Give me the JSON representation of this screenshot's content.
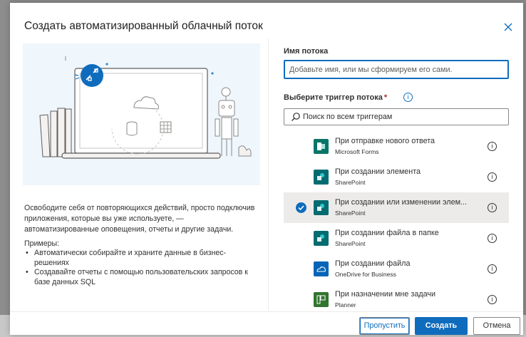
{
  "dialog": {
    "title": "Создать автоматизированный облачный поток",
    "close_label": "×"
  },
  "left": {
    "description": "Освободите себя от повторяющихся действий, просто подключив приложения, которые вы уже используете, — автоматизированные оповещения, отчеты и другие задачи.",
    "examples_title": "Примеры:",
    "examples": [
      "Автоматически собирайте и храните данные в бизнес-решениях",
      "Создавайте отчеты с помощью пользовательских запросов к базе данных SQL"
    ]
  },
  "flow_name": {
    "label": "Имя потока",
    "placeholder": "Добавьте имя, или мы сформируем его сами.",
    "value": ""
  },
  "trigger": {
    "label": "Выберите триггер потока",
    "required_mark": "*",
    "info_icon": "info-icon",
    "search_placeholder": "Поиск по всем триггерам",
    "items": [
      {
        "title": "При отправке нового ответа",
        "subtitle": "Microsoft Forms",
        "icon": "forms-icon",
        "color": "#077568",
        "selected": false
      },
      {
        "title": "При создании элемента",
        "subtitle": "SharePoint",
        "icon": "sharepoint-icon",
        "color": "#036c70",
        "selected": false
      },
      {
        "title": "При создании или изменении элем...",
        "subtitle": "SharePoint",
        "icon": "sharepoint-icon",
        "color": "#036c70",
        "selected": true
      },
      {
        "title": "При создании файла в папке",
        "subtitle": "SharePoint",
        "icon": "sharepoint-icon",
        "color": "#036c70",
        "selected": false
      },
      {
        "title": "При создании файла",
        "subtitle": "OneDrive for Business",
        "icon": "onedrive-icon",
        "color": "#0364b8",
        "selected": false
      },
      {
        "title": "При назначении мне задачи",
        "subtitle": "Planner",
        "icon": "planner-icon",
        "color": "#31752f",
        "selected": false
      }
    ]
  },
  "footer": {
    "skip_label": "Пропустить",
    "create_label": "Создать",
    "cancel_label": "Отмена"
  },
  "colors": {
    "accent": "#0f6cbd",
    "selected_row": "#edebe9"
  }
}
